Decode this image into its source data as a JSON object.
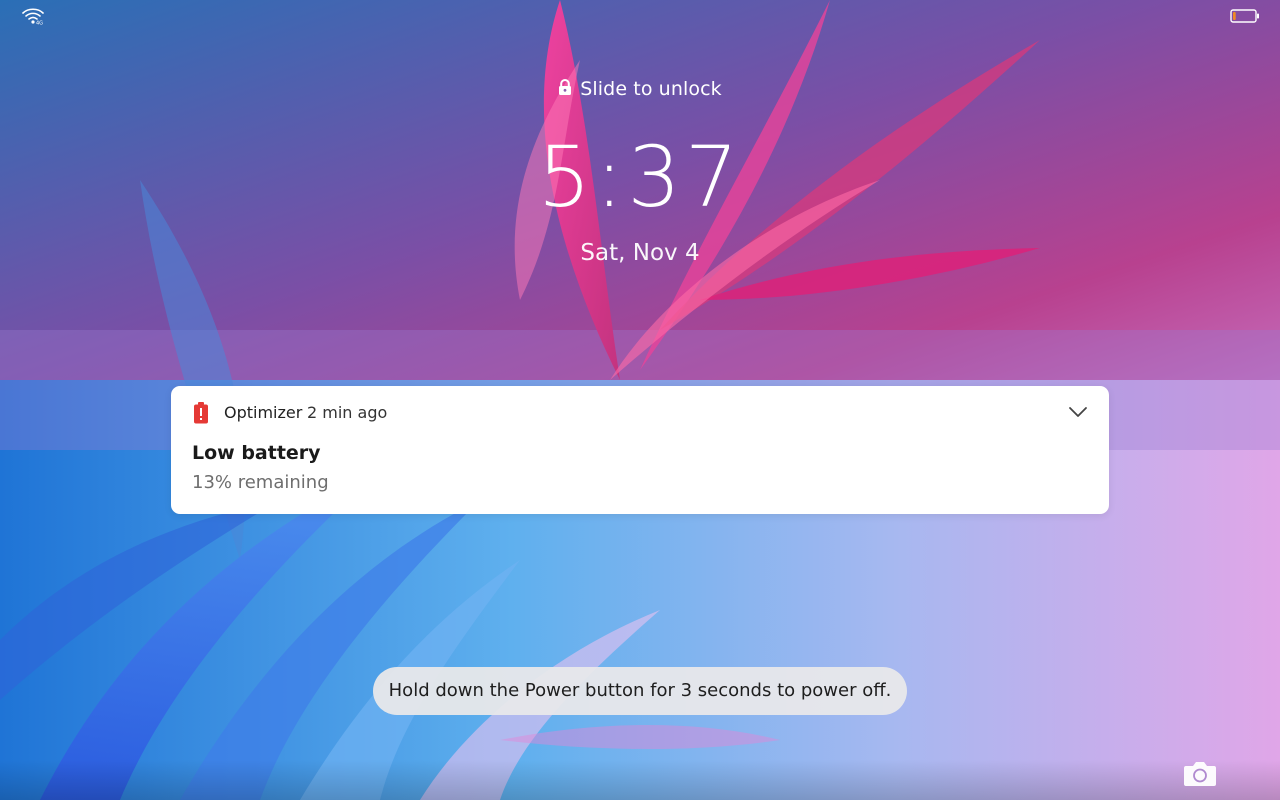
{
  "status_bar": {
    "wifi_icon": "wifi-icon",
    "battery_icon": "battery-low-icon",
    "battery_fill_fraction": 0.13,
    "battery_color": "#f08a24"
  },
  "lock_screen": {
    "unlock_hint": "Slide to unlock",
    "time": "5:37",
    "date": "Sat, Nov 4"
  },
  "notification": {
    "app_icon": "battery-alert-icon",
    "app_icon_color": "#e53935",
    "app_name": "Optimizer",
    "time_ago": "2 min ago",
    "title": "Low battery",
    "body": "13% remaining",
    "expand_icon": "chevron-down-icon"
  },
  "toast": {
    "message": "Hold down the Power button for 3 seconds to power off."
  },
  "camera": {
    "icon": "camera-icon"
  }
}
